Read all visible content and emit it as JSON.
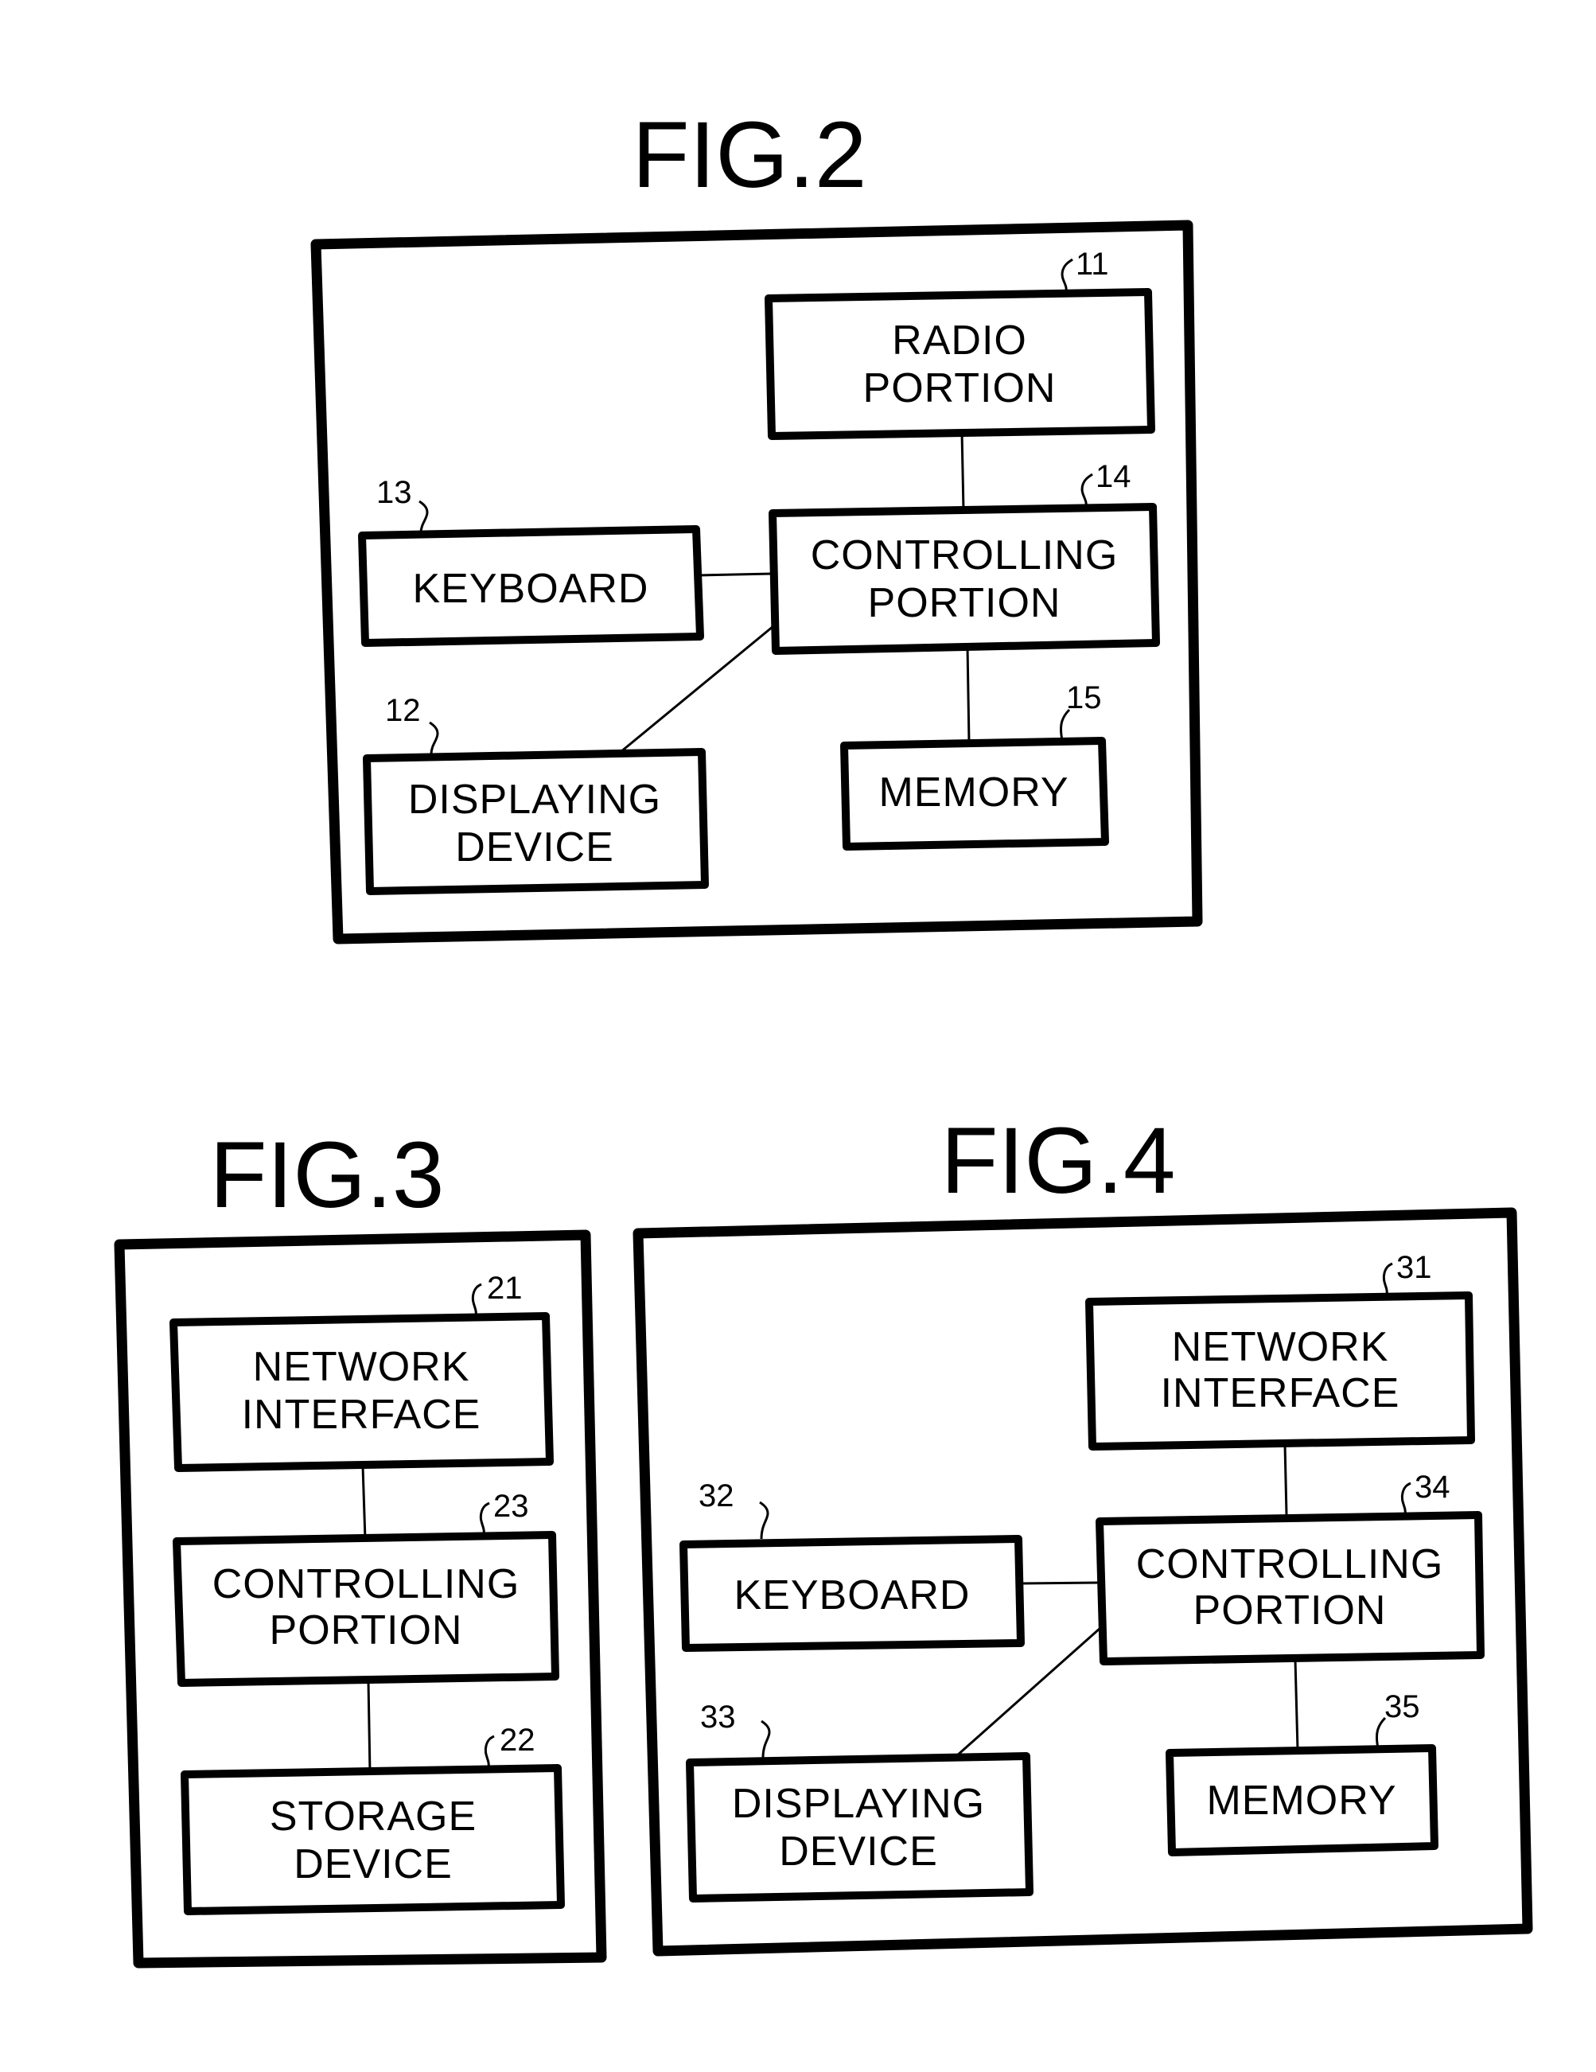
{
  "figures": [
    {
      "id": "fig2",
      "title": "FIG.2",
      "blocks": [
        {
          "key": "radio",
          "ref": "11",
          "lines": [
            "RADIO",
            "PORTION"
          ]
        },
        {
          "key": "controlling",
          "ref": "14",
          "lines": [
            "CONTROLLING",
            "PORTION"
          ]
        },
        {
          "key": "keyboard",
          "ref": "13",
          "lines": [
            "KEYBOARD"
          ]
        },
        {
          "key": "displaying",
          "ref": "12",
          "lines": [
            "DISPLAYING",
            "DEVICE"
          ]
        },
        {
          "key": "memory",
          "ref": "15",
          "lines": [
            "MEMORY"
          ]
        }
      ],
      "connections": [
        [
          "radio",
          "controlling"
        ],
        [
          "keyboard",
          "controlling"
        ],
        [
          "displaying",
          "controlling"
        ],
        [
          "memory",
          "controlling"
        ]
      ]
    },
    {
      "id": "fig3",
      "title": "FIG.3",
      "blocks": [
        {
          "key": "network",
          "ref": "21",
          "lines": [
            "NETWORK",
            "INTERFACE"
          ]
        },
        {
          "key": "controlling",
          "ref": "23",
          "lines": [
            "CONTROLLING",
            "PORTION"
          ]
        },
        {
          "key": "storage",
          "ref": "22",
          "lines": [
            "STORAGE",
            "DEVICE"
          ]
        }
      ],
      "connections": [
        [
          "network",
          "controlling"
        ],
        [
          "controlling",
          "storage"
        ]
      ]
    },
    {
      "id": "fig4",
      "title": "FIG.4",
      "blocks": [
        {
          "key": "network",
          "ref": "31",
          "lines": [
            "NETWORK",
            "INTERFACE"
          ]
        },
        {
          "key": "controlling",
          "ref": "34",
          "lines": [
            "CONTROLLING",
            "PORTION"
          ]
        },
        {
          "key": "keyboard",
          "ref": "32",
          "lines": [
            "KEYBOARD"
          ]
        },
        {
          "key": "displaying",
          "ref": "33",
          "lines": [
            "DISPLAYING",
            "DEVICE"
          ]
        },
        {
          "key": "memory",
          "ref": "35",
          "lines": [
            "MEMORY"
          ]
        }
      ],
      "connections": [
        [
          "network",
          "controlling"
        ],
        [
          "keyboard",
          "controlling"
        ],
        [
          "displaying",
          "controlling"
        ],
        [
          "memory",
          "controlling"
        ]
      ]
    }
  ]
}
